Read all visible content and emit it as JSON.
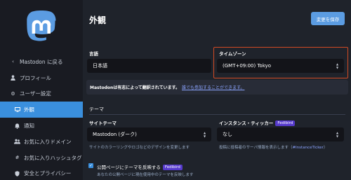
{
  "sidebar": {
    "items": [
      {
        "label": "Mastodon に戻る",
        "icon": "chevron-left-icon"
      },
      {
        "label": "プロフィール",
        "icon": "user-icon"
      },
      {
        "label": "ユーザー設定",
        "icon": "gear-icon"
      },
      {
        "label": "外観",
        "icon": "desktop-icon"
      },
      {
        "label": "通知",
        "icon": "bell-icon"
      },
      {
        "label": "お気に入りドメイン",
        "icon": "users-icon"
      },
      {
        "label": "お気に入りハッシュタグ",
        "icon": "hashtag-icon"
      },
      {
        "label": "安全とプライバシー",
        "icon": "shield-icon"
      }
    ]
  },
  "header": {
    "title": "外観",
    "save_label": "変更を保存"
  },
  "language": {
    "label": "言語",
    "value": "日本語"
  },
  "timezone": {
    "label": "タイムゾーン",
    "value": "(GMT+09:00) Tokyo"
  },
  "notice": {
    "bold": "Mastodonは有志によって翻訳されています。",
    "link": "誰でも参加することができます。"
  },
  "theme_section": {
    "title": "テーマ"
  },
  "site_theme": {
    "label": "サイトテーマ",
    "value": "Mastodon (ダーク)",
    "hint": "サイトのカラーリングやロゴなどのデザインを変更します"
  },
  "instance_ticker": {
    "label": "インスタンス・ティッカー",
    "badge": "Fedibird",
    "value": "なし",
    "hint_prefix": "投稿に投稿者のサーバ情報を表示します（",
    "hint_link": "#InstanceTicker",
    "hint_suffix": "）"
  },
  "theme_public": {
    "label": "公開ページにテーマを反映する",
    "badge": "Fedibird",
    "hint": "あなたの公開ページに現在使用中のテーマを反映します",
    "checked": true
  },
  "colors": {
    "accent": "#3a8fdd",
    "highlight_border": "#d24a24",
    "badge": "#563acc"
  }
}
